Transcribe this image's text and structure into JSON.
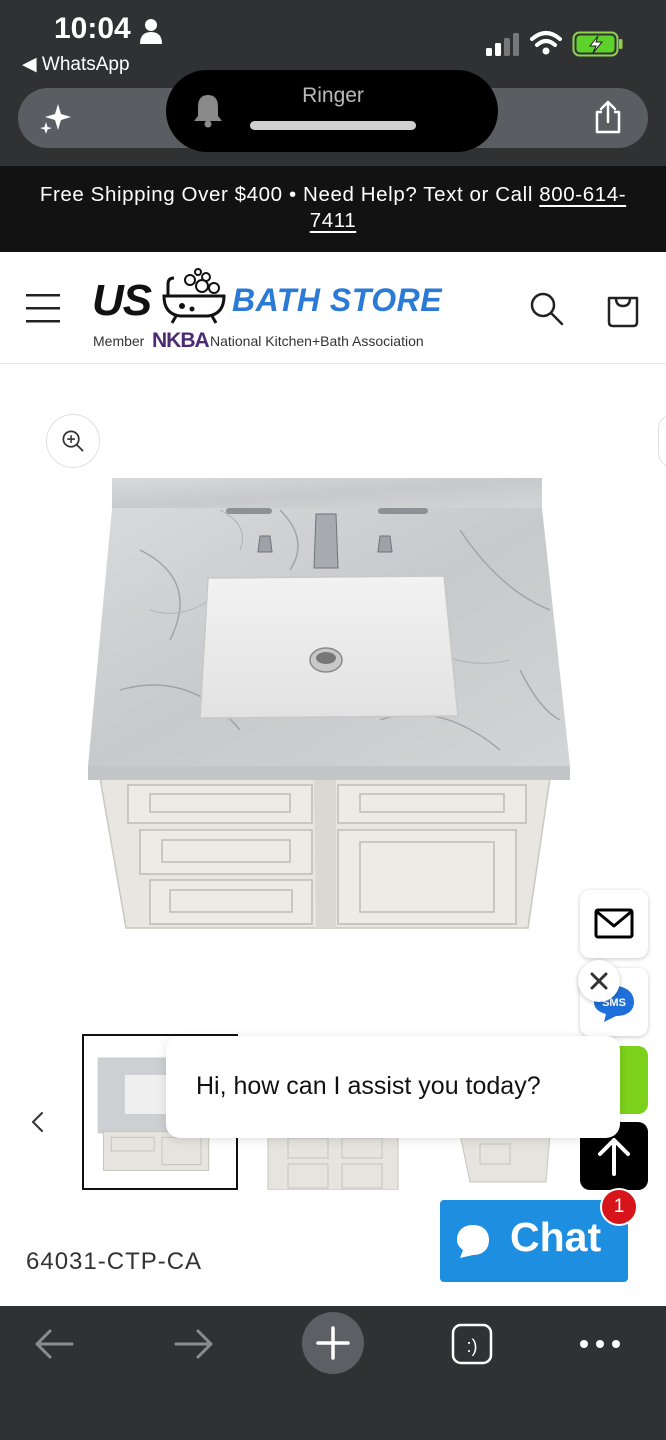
{
  "status_bar": {
    "time": "10:04",
    "back_app": "◀ WhatsApp"
  },
  "ringer": {
    "label": "Ringer"
  },
  "announcement": {
    "text": "Free Shipping Over $400 • Need Help? Text or Call ",
    "phone": "800-614-7411"
  },
  "header": {
    "logo_us": "US",
    "logo_bath": "BATH STORE",
    "logo_member": "Member",
    "logo_nkba": "NKBA",
    "logo_association": "National Kitchen+Bath Association"
  },
  "product": {
    "sku": "64031-CTP-CA"
  },
  "chat": {
    "greeting": "Hi, how can I assist you today?",
    "button_label": "Chat",
    "badge_count": "1"
  },
  "colors": {
    "chrome_bg": "#2f3133",
    "announcement_bg": "#121212",
    "brand_blue": "#2a7ad6",
    "chat_blue": "#1e8fe0",
    "badge_red": "#d6141a",
    "whatsapp_green": "#7cd11a"
  },
  "icons": {
    "status": [
      "person-icon",
      "signal-icon",
      "wifi-icon",
      "battery-icon"
    ],
    "browser": [
      "sparkle-icon",
      "share-icon",
      "bell-icon"
    ],
    "header": [
      "menu-icon",
      "search-icon",
      "cart-icon"
    ],
    "product": [
      "zoom-in-icon",
      "chevron-left-icon"
    ],
    "widgets": [
      "mail-icon",
      "sms-icon",
      "close-icon",
      "arrow-up-icon",
      "chat-bubble-icon"
    ],
    "toolbar": [
      "arrow-left-icon",
      "arrow-right-icon",
      "plus-icon",
      "tabs-icon",
      "more-icon"
    ]
  }
}
